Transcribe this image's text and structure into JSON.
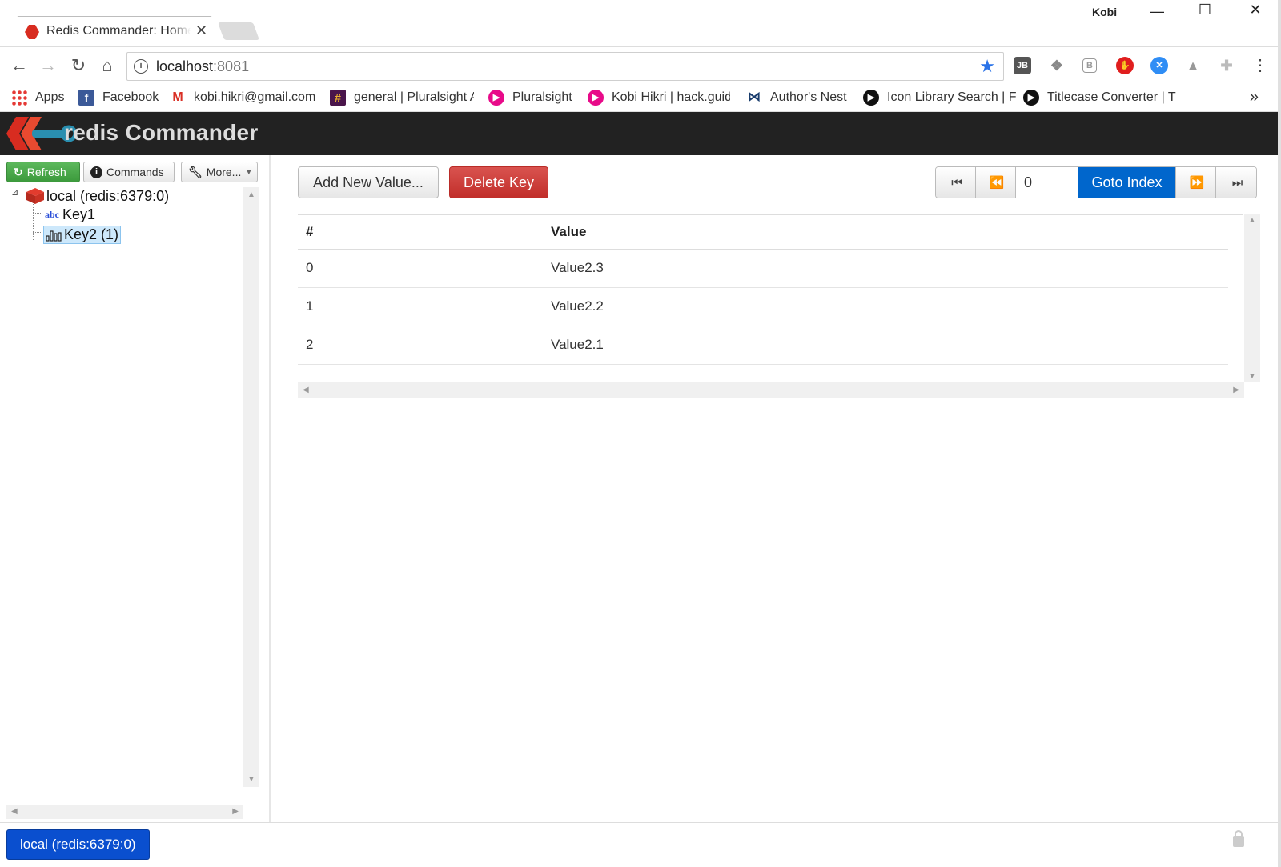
{
  "browser": {
    "tab_title": "Redis Commander: Home",
    "user": "Kobi",
    "url_host": "localhost",
    "url_port": ":8081",
    "bookmarks": [
      {
        "label": "Apps",
        "icon": "apps-grid-icon"
      },
      {
        "label": "Facebook",
        "icon": "facebook-icon"
      },
      {
        "label": "kobi.hikri@gmail.com",
        "icon": "gmail-icon"
      },
      {
        "label": "general | Pluralsight A",
        "icon": "slack-icon"
      },
      {
        "label": "Pluralsight",
        "icon": "pluralsight-icon"
      },
      {
        "label": "Kobi Hikri | hack.guid",
        "icon": "pluralsight-icon"
      },
      {
        "label": "Author's Nest",
        "icon": "authors-nest-icon"
      },
      {
        "label": "Icon Library Search | F",
        "icon": "play-circle-icon"
      },
      {
        "label": "Titlecase Converter | T",
        "icon": "play-circle-icon"
      }
    ],
    "more_bookmarks": "»",
    "extensions": [
      "JB",
      "dropbox",
      "B",
      "adblock",
      "messenger",
      "drive",
      "puzzle"
    ]
  },
  "app": {
    "title": "redis Commander"
  },
  "sidebar": {
    "refresh_label": "Refresh",
    "commands_label": "Commands",
    "more_label": "More...",
    "tree": {
      "server": "local (redis:6379:0)",
      "keys": [
        {
          "type_badge": "abc",
          "label": "Key1",
          "type": "string"
        },
        {
          "type_badge": "list",
          "label": "Key2 (1)",
          "type": "list",
          "selected": true
        }
      ]
    }
  },
  "main": {
    "add_button": "Add New Value...",
    "delete_button": "Delete Key",
    "pager": {
      "first": "⏮",
      "prev": "⏪",
      "index_value": "0",
      "goto_label": "Goto Index",
      "next": "⏩",
      "last": "⏭"
    },
    "table": {
      "headers": [
        "#",
        "Value"
      ],
      "rows": [
        {
          "index": "0",
          "value": "Value2.3"
        },
        {
          "index": "1",
          "value": "Value2.2"
        },
        {
          "index": "2",
          "value": "Value2.1"
        }
      ]
    }
  },
  "footer": {
    "connection": "local (redis:6379:0)"
  },
  "colors": {
    "header_bg": "#222222",
    "refresh_green": "#5cb85c",
    "delete_red": "#d9534f",
    "goto_blue": "#0066cc",
    "connection_blue": "#0a4fcf",
    "selection_bg": "#cde8fb"
  }
}
